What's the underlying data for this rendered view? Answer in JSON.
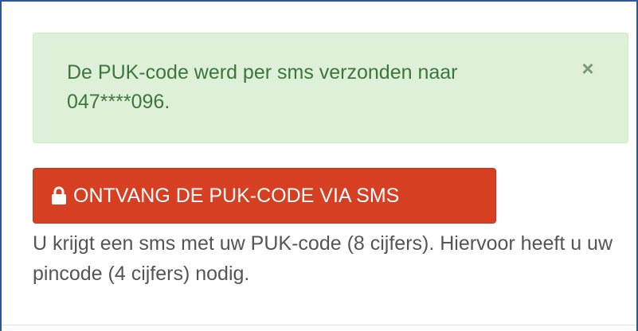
{
  "alert": {
    "message": "De PUK-code werd per sms verzonden naar 047****096.",
    "close_symbol": "×",
    "close_icon": "close-icon",
    "background_color": "#dff0d8",
    "text_color": "#3c763d"
  },
  "puk_button": {
    "label": "ONTVANG DE PUK-CODE VIA SMS",
    "icon": "lock-icon",
    "background_color": "#d73f22"
  },
  "help": {
    "text": "U krijgt een sms met uw PUK-code (8 cijfers). Hiervoor heeft u uw pincode (4 cijfers) nodig."
  }
}
